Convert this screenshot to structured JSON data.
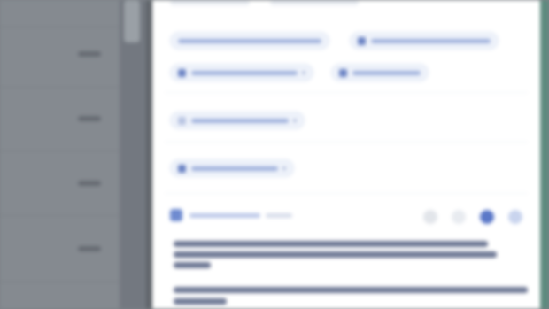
{
  "colors": {
    "backdrop": "#7d8288",
    "dialog_background": "#ffffff",
    "chip_text": "#4a63a8",
    "chip_background": "#eef2fa",
    "accent": "#6f8bd0",
    "right_edge": "#5d8a7e"
  },
  "note": "",
  "left_list": {
    "rows": [
      "",
      "",
      "",
      ""
    ]
  },
  "chips": [
    {
      "label": "",
      "icon": ""
    },
    {
      "label": "",
      "icon": ""
    },
    {
      "label": "",
      "icon": "dropdown-icon"
    },
    {
      "label": "",
      "icon": "dropdown-icon"
    },
    {
      "label": "",
      "icon": "dropdown-icon"
    },
    {
      "label": "",
      "icon": "dropdown-icon"
    }
  ],
  "task": {
    "title": "",
    "meta": "",
    "actions": [
      "more-icon",
      "edit-icon",
      "user-icon",
      "add-icon"
    ],
    "body_lines": [
      "",
      "",
      "",
      "",
      ""
    ]
  }
}
